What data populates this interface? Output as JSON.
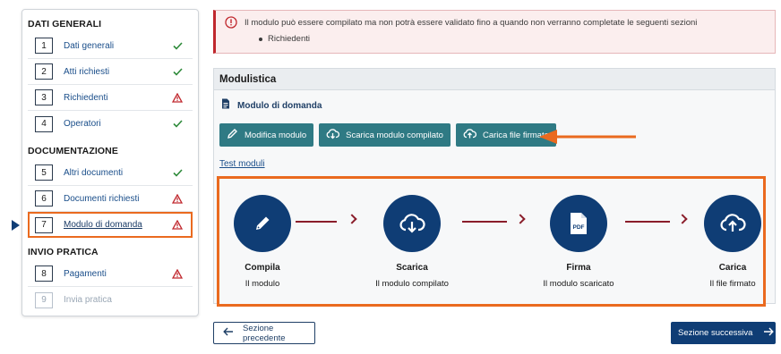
{
  "sidebar": {
    "sections": [
      {
        "title": "DATI GENERALI",
        "items": [
          {
            "num": "1",
            "label": "Dati generali",
            "status": "ok"
          },
          {
            "num": "2",
            "label": "Atti richiesti",
            "status": "ok"
          },
          {
            "num": "3",
            "label": "Richiedenti",
            "status": "warning"
          },
          {
            "num": "4",
            "label": "Operatori",
            "status": "ok"
          }
        ]
      },
      {
        "title": "DOCUMENTAZIONE",
        "items": [
          {
            "num": "5",
            "label": "Altri documenti",
            "status": "ok"
          },
          {
            "num": "6",
            "label": "Documenti richiesti",
            "status": "warning"
          },
          {
            "num": "7",
            "label": "Modulo di domanda",
            "status": "warning",
            "active": true
          }
        ]
      },
      {
        "title": "INVIO PRATICA",
        "items": [
          {
            "num": "8",
            "label": "Pagamenti",
            "status": "warning"
          },
          {
            "num": "9",
            "label": "Invia pratica",
            "status": "disabled"
          }
        ]
      }
    ]
  },
  "alert": {
    "message": "Il modulo può essere compilato ma non potrà essere validato fino a quando non verranno completate le seguenti sezioni",
    "items": [
      "Richiedenti"
    ]
  },
  "panel": {
    "title": "Modulistica",
    "subtitle": "Modulo di domanda",
    "buttons": {
      "edit": "Modifica modulo",
      "download": "Scarica modulo compilato",
      "upload": "Carica file firmato"
    },
    "test_link": "Test moduli",
    "steps": [
      {
        "title": "Compila",
        "sub": "Il modulo",
        "icon": "pencil-icon"
      },
      {
        "title": "Scarica",
        "sub": "Il modulo compilato",
        "icon": "cloud-download-icon"
      },
      {
        "title": "Firma",
        "sub": "Il modulo scaricato",
        "icon": "pdf-icon"
      },
      {
        "title": "Carica",
        "sub": "Il file firmato",
        "icon": "cloud-upload-icon"
      }
    ]
  },
  "footer": {
    "prev": "Sezione precedente",
    "next": "Sezione successiva"
  },
  "colors": {
    "primary": "#0f3d75",
    "teal": "#2f7a84",
    "highlight": "#ea6a1f",
    "ok": "#2e8a3a",
    "warning": "#c0272d"
  }
}
